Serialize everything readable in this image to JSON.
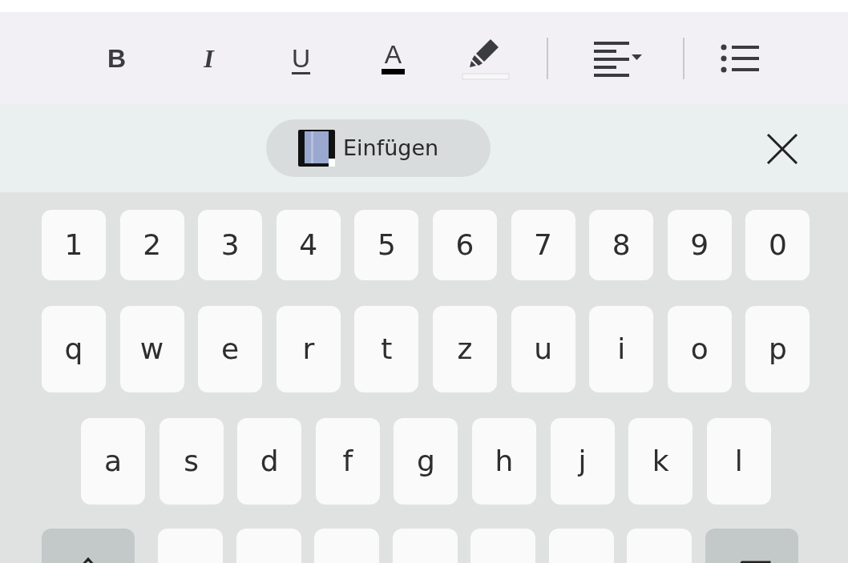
{
  "toolbar": {
    "items": [
      {
        "kind": "bold",
        "label": "B"
      },
      {
        "kind": "italic",
        "label": "I"
      },
      {
        "kind": "underline",
        "label": "U"
      },
      {
        "kind": "text_color",
        "label": "A"
      },
      {
        "kind": "highlight"
      },
      {
        "kind": "divider"
      },
      {
        "kind": "align"
      },
      {
        "kind": "divider"
      },
      {
        "kind": "list"
      }
    ]
  },
  "clipboard": {
    "paste_label": "Einfügen"
  },
  "keyboard": {
    "rows": [
      [
        "1",
        "2",
        "3",
        "4",
        "5",
        "6",
        "7",
        "8",
        "9",
        "0"
      ],
      [
        "q",
        "w",
        "e",
        "r",
        "t",
        "z",
        "u",
        "i",
        "o",
        "p"
      ],
      [
        "a",
        "s",
        "d",
        "f",
        "g",
        "h",
        "j",
        "k",
        "l"
      ]
    ],
    "bottom_row": [
      {
        "kind": "shift"
      },
      {
        "kind": "letter"
      },
      {
        "kind": "letter"
      },
      {
        "kind": "letter"
      },
      {
        "kind": "letter"
      },
      {
        "kind": "letter"
      },
      {
        "kind": "letter"
      },
      {
        "kind": "letter"
      },
      {
        "kind": "backspace"
      }
    ]
  }
}
